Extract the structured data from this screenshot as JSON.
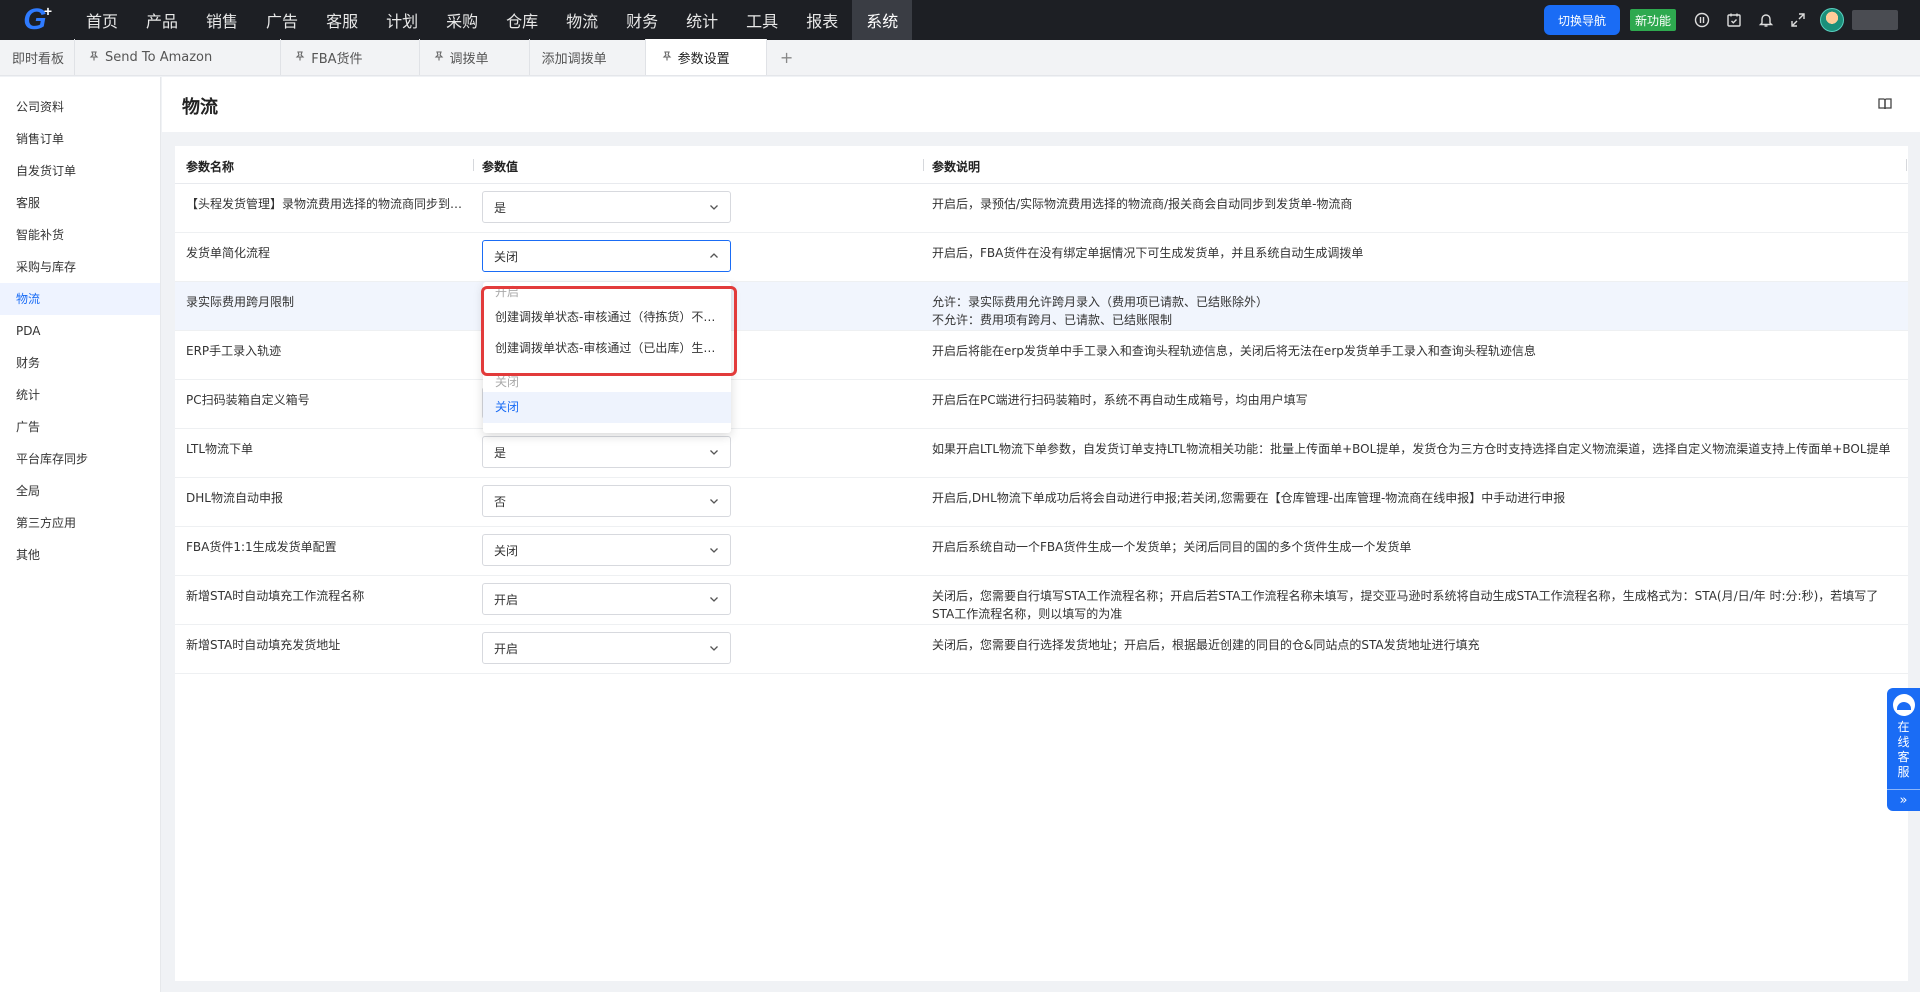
{
  "nav": {
    "items": [
      "首页",
      "产品",
      "销售",
      "广告",
      "客服",
      "计划",
      "采购",
      "仓库",
      "物流",
      "财务",
      "统计",
      "工具",
      "报表",
      "系统"
    ],
    "active_index": 13,
    "switch_nav": "切换导航",
    "new_feature": "新功能"
  },
  "tabs": [
    {
      "label": "即时看板",
      "pinned": false
    },
    {
      "label": "Send To Amazon",
      "pinned": true
    },
    {
      "label": "FBA货件",
      "pinned": true
    },
    {
      "label": "调拨单",
      "pinned": true
    },
    {
      "label": "添加调拨单",
      "pinned": false
    },
    {
      "label": "参数设置",
      "pinned": true,
      "active": true
    }
  ],
  "tab_add": "+",
  "sidebar": {
    "items": [
      "公司资料",
      "销售订单",
      "自发货订单",
      "客服",
      "智能补货",
      "采购与库存",
      "物流",
      "PDA",
      "财务",
      "统计",
      "广告",
      "平台库存同步",
      "全局",
      "第三方应用",
      "其他"
    ],
    "active_index": 6
  },
  "page": {
    "title": "物流"
  },
  "table": {
    "headers": [
      "参数名称",
      "参数值",
      "参数说明"
    ],
    "rows": [
      {
        "name": "【头程发货管理】录物流费用选择的物流商同步到发货单",
        "value": "是",
        "desc": "开启后，录预估/实际物流费用选择的物流商/报关商会自动同步到发货单-物流商"
      },
      {
        "name": "发货单简化流程",
        "value": "关闭",
        "desc": "开启后，FBA货件在没有绑定单据情况下可生成发货单，并且系统自动生成调拨单"
      },
      {
        "name": "录实际费用跨月限制",
        "value": "",
        "desc": "允许：录实际费用允许跨月录入（费用项已请款、已结账除外）\n不允许：费用项有跨月、已请款、已结账限制"
      },
      {
        "name": "ERP手工录入轨迹",
        "value": "",
        "desc": "开启后将能在erp发货单中手工录入和查询头程轨迹信息，关闭后将无法在erp发货单手工录入和查询头程轨迹信息"
      },
      {
        "name": "PC扫码装箱自定义箱号",
        "value": "",
        "desc": "开启后在PC端进行扫码装箱时，系统不再自动生成箱号，均由用户填写"
      },
      {
        "name": "LTL物流下单",
        "value": "是",
        "desc": "如果开启LTL物流下单参数，自发货订单支持LTL物流相关功能：批量上传面单+BOL提单，发货仓为三方仓时支持选择自定义物流渠道，选择自定义物流渠道支持上传面单+BOL提单"
      },
      {
        "name": "DHL物流自动申报",
        "value": "否",
        "desc": "开启后,DHL物流下单成功后将会自动进行申报;若关闭,您需要在【仓库管理-出库管理-物流商在线申报】中手动进行申报"
      },
      {
        "name": "FBA货件1:1生成发货单配置",
        "value": "关闭",
        "desc": "开启后系统自动一个FBA货件生成一个发货单；关闭后同目的国的多个货件生成一个发货单"
      },
      {
        "name": "新增STA时自动填充工作流程名称",
        "value": "开启",
        "desc": "关闭后，您需要自行填写STA工作流程名称；开启后若STA工作流程名称未填写，提交亚马逊时系统将自动生成STA工作流程名称，生成格式为：STA(月/日/年 时:分:秒)，若填写了STA工作流程名称，则以填写的为准"
      },
      {
        "name": "新增STA时自动填充发货地址",
        "value": "开启",
        "desc": "关闭后，您需要自行选择发货地址；开启后，根据最近创建的同目的仓&同站点的STA发货地址进行填充"
      }
    ]
  },
  "dropdown": {
    "group_on": "开启",
    "options_on": [
      "创建调拨单状态-审核通过（待拣货）不生成发货单",
      "创建调拨单状态-审核通过（已出库）生成发货单"
    ],
    "group_off": "关闭",
    "options_off": [
      "关闭"
    ],
    "selected": "关闭"
  },
  "service": {
    "label": "在线客服",
    "arrow": "»"
  },
  "colors": {
    "primary": "#1a6cf5",
    "highlight_border": "#e23b3b",
    "nav_bg": "#1d1f24",
    "new_badge": "#2ea94f"
  }
}
